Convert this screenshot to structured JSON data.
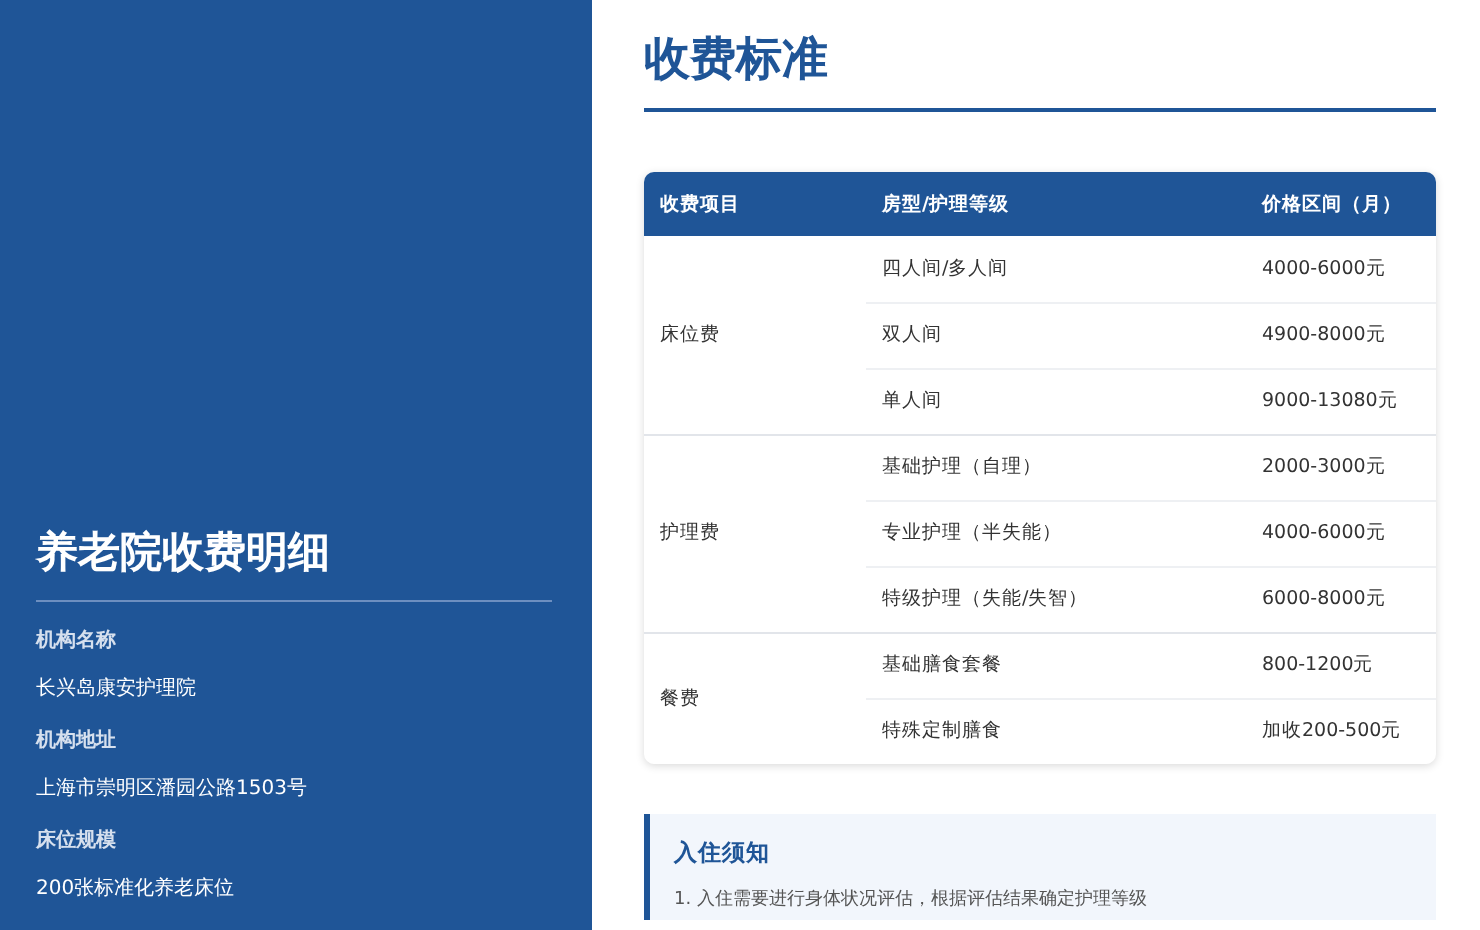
{
  "sidebar": {
    "title": "养老院收费明细",
    "fields": [
      {
        "label": "机构名称",
        "value": "长兴岛康安护理院"
      },
      {
        "label": "机构地址",
        "value": "上海市崇明区潘园公路1503号"
      },
      {
        "label": "床位规模",
        "value": "200张标准化养老床位"
      }
    ]
  },
  "main": {
    "title": "收费标准",
    "table": {
      "columns": [
        "收费项目",
        "房型/护理等级",
        "价格区间（月）"
      ],
      "groups": [
        {
          "item": "床位费",
          "rows": [
            {
              "type": "四人间/多人间",
              "price": "4000-6000元"
            },
            {
              "type": "双人间",
              "price": "4900-8000元"
            },
            {
              "type": "单人间",
              "price": "9000-13080元"
            }
          ]
        },
        {
          "item": "护理费",
          "rows": [
            {
              "type": "基础护理（自理）",
              "price": "2000-3000元"
            },
            {
              "type": "专业护理（半失能）",
              "price": "4000-6000元"
            },
            {
              "type": "特级护理（失能/失智）",
              "price": "6000-8000元"
            }
          ]
        },
        {
          "item": "餐费",
          "rows": [
            {
              "type": "基础膳食套餐",
              "price": "800-1200元"
            },
            {
              "type": "特殊定制膳食",
              "price": "加收200-500元"
            }
          ]
        }
      ]
    },
    "notice": {
      "title": "入住须知",
      "lines": [
        "1. 入住需要进行身体状况评估，根据评估结果确定护理等级"
      ]
    }
  }
}
